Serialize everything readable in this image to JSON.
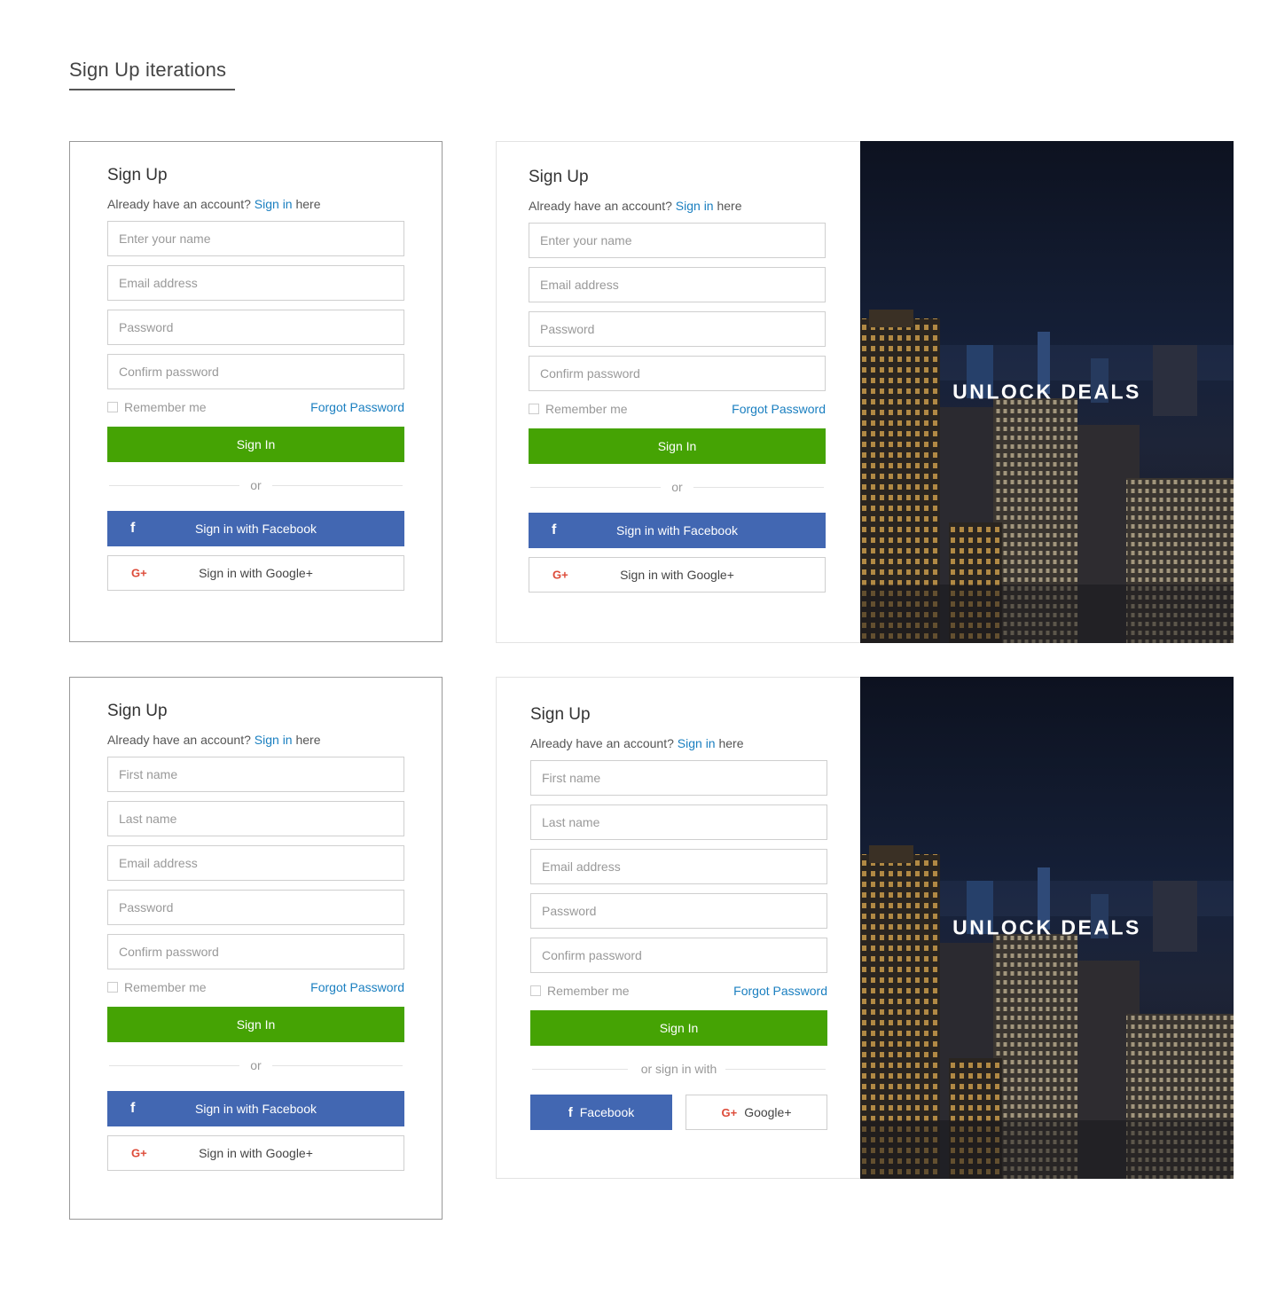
{
  "page": {
    "title": "Sign Up iterations"
  },
  "form_common": {
    "title": "Sign Up",
    "already_prefix": "Already have an account? ",
    "sign_in_link": "Sign in",
    "already_suffix": " here",
    "remember": "Remember me",
    "forgot": "Forgot Password",
    "primary_button": "Sign In",
    "divider": "or",
    "facebook_button": "Sign in with Facebook",
    "google_button": "Sign in with Google+"
  },
  "placeholders": {
    "name": "Enter your name",
    "first_name": "First name",
    "last_name": "Last name",
    "email": "Email address",
    "password": "Password",
    "confirm": "Confirm password"
  },
  "variant4": {
    "divider": "or sign in with",
    "facebook": "Facebook",
    "google": "Google+"
  },
  "hero": {
    "text": "UNLOCK DEALS"
  },
  "icons": {
    "facebook_glyph": "f",
    "google_glyph": "G+"
  },
  "colors": {
    "primary_green": "#45a304",
    "facebook_blue": "#4267b2",
    "link_blue": "#1a7fc0",
    "google_red": "#dd4b39"
  }
}
